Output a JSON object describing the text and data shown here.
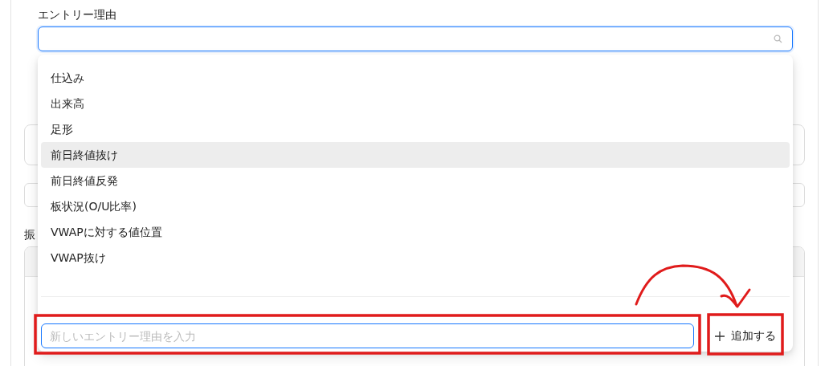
{
  "background": {
    "label": "振"
  },
  "field": {
    "label": "エントリー理由"
  },
  "options": [
    {
      "label": "仕込み",
      "selected": false
    },
    {
      "label": "出来高",
      "selected": false
    },
    {
      "label": "足形",
      "selected": false
    },
    {
      "label": "前日終値抜け",
      "selected": true
    },
    {
      "label": "前日終値反発",
      "selected": false
    },
    {
      "label": "板状況(O/U比率)",
      "selected": false
    },
    {
      "label": "VWAPに対する値位置",
      "selected": false
    },
    {
      "label": "VWAP抜け",
      "selected": false
    }
  ],
  "new_reason": {
    "placeholder": "新しいエントリー理由を入力"
  },
  "add_button": {
    "label": "追加する"
  }
}
